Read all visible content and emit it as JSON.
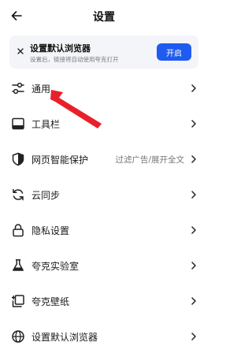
{
  "header": {
    "title": "设置",
    "back_icon": "back-arrow-icon"
  },
  "banner": {
    "title": "设置默认浏览器",
    "subtitle": "设置后，链接将自动使用夸克打开",
    "button_label": "开启",
    "accent_color": "#1f5bf0"
  },
  "menu": {
    "items": [
      {
        "label": "通用",
        "value": "",
        "icon": "sliders-icon"
      },
      {
        "label": "工具栏",
        "value": "",
        "icon": "toolbar-icon"
      },
      {
        "label": "网页智能保护",
        "value": "过滤广告/展开全文",
        "icon": "shield-icon"
      },
      {
        "label": "云同步",
        "value": "",
        "icon": "sync-icon"
      },
      {
        "label": "隐私设置",
        "value": "",
        "icon": "lock-icon"
      },
      {
        "label": "夸克实验室",
        "value": "",
        "icon": "flask-icon"
      },
      {
        "label": "夸克壁纸",
        "value": "",
        "icon": "wallpaper-icon"
      },
      {
        "label": "设置默认浏览器",
        "value": "",
        "icon": "globe-icon"
      }
    ]
  },
  "annotation_color": "#e8202a"
}
